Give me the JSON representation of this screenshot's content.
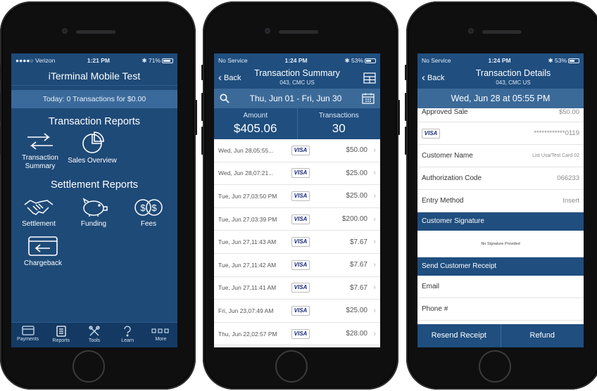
{
  "phone1": {
    "status": {
      "carrier": "●●●●○ Verizon",
      "time": "1:21 PM",
      "battery": "71%"
    },
    "title": "iTerminal Mobile Test",
    "today": "Today: 0 Transactions for $0.00",
    "transaction_reports": {
      "heading": "Transaction Reports",
      "items": [
        {
          "label": "Transaction Summary",
          "icon": "arrows-swap-icon"
        },
        {
          "label": "Sales Overview",
          "icon": "pie-chart-icon"
        }
      ]
    },
    "settlement_reports": {
      "heading": "Settlement Reports",
      "items": [
        {
          "label": "Settlement",
          "icon": "handshake-icon"
        },
        {
          "label": "Funding",
          "icon": "piggy-bank-icon"
        },
        {
          "label": "Fees",
          "icon": "dollar-coins-icon"
        }
      ],
      "extra": {
        "label": "Chargeback",
        "icon": "card-arrow-icon"
      }
    },
    "tabs": [
      "Payments",
      "Reports",
      "Tools",
      "Learn",
      "More"
    ]
  },
  "phone2": {
    "status": {
      "carrier": "No Service",
      "time": "1:24 PM",
      "battery": "53%"
    },
    "back": "Back",
    "title": "Transaction Summary",
    "subtitle": "043, CMC US",
    "date_range": "Thu, Jun 01 - Fri, Jun 30",
    "summary": {
      "amount_label": "Amount",
      "amount": "$405.06",
      "count_label": "Transactions",
      "count": "30"
    },
    "transactions": [
      {
        "date": "Wed, Jun 28,05:55...",
        "card": "VISA",
        "amount": "$50.00"
      },
      {
        "date": "Wed, Jun 28,07:21...",
        "card": "VISA",
        "amount": "$25.00"
      },
      {
        "date": "Tue, Jun 27,03:50 PM",
        "card": "VISA",
        "amount": "$25.00"
      },
      {
        "date": "Tue, Jun 27,03:39 PM",
        "card": "VISA",
        "amount": "$200.00"
      },
      {
        "date": "Tue, Jun 27,11:43 AM",
        "card": "VISA",
        "amount": "$7.67"
      },
      {
        "date": "Tue, Jun 27,11:42 AM",
        "card": "VISA",
        "amount": "$7.67"
      },
      {
        "date": "Tue, Jun 27,11:41 AM",
        "card": "VISA",
        "amount": "$7.67"
      },
      {
        "date": "Fri, Jun 23,07:49 AM",
        "card": "VISA",
        "amount": "$25.00"
      },
      {
        "date": "Thu, Jun 22,02:57 PM",
        "card": "VISA",
        "amount": "$28.00"
      }
    ]
  },
  "phone3": {
    "status": {
      "carrier": "No Service",
      "time": "1:24 PM",
      "battery": "53%"
    },
    "back": "Back",
    "title": "Transaction Details",
    "subtitle": "043, CMC US",
    "datetime": "Wed, Jun 28 at 05:55 PM",
    "approved": {
      "label": "Approved Sale",
      "value": "$50.00"
    },
    "card": {
      "brand": "VISA",
      "number": "************0119"
    },
    "rows": [
      {
        "label": "Customer Name",
        "value": "List Usa/Test Card 02"
      },
      {
        "label": "Authorization Code",
        "value": "066233"
      },
      {
        "label": "Entry Method",
        "value": "Insert"
      }
    ],
    "signature_heading": "Customer Signature",
    "signature_text": "No Signature Provided",
    "receipt_heading": "Send Customer Receipt",
    "email_placeholder": "Email",
    "phone_placeholder": "Phone #",
    "resend": "Resend Receipt",
    "refund": "Refund"
  },
  "colors": {
    "primary": "#1f4e7f",
    "secondary": "#3b6a99",
    "dark": "#143a63"
  }
}
